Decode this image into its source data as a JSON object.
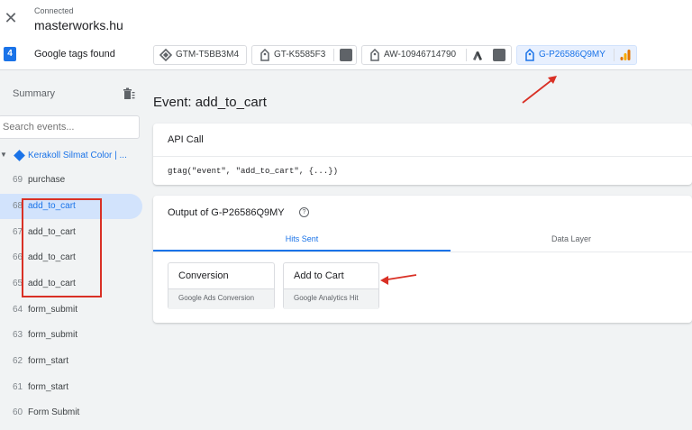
{
  "header": {
    "status": "Connected",
    "domain": "masterworks.hu"
  },
  "tags_bar": {
    "count": "4",
    "label": "Google tags found",
    "tags": [
      {
        "id": "GTM-T5BB3M4",
        "icon": "gtm-diamond-icon"
      },
      {
        "id": "GT-K5585F3",
        "icon": "tag-icon"
      },
      {
        "id": "AW-10946714790",
        "icon": "tag-icon"
      },
      {
        "id": "G-P26586Q9MY",
        "icon": "tag-icon",
        "active": true
      }
    ]
  },
  "sidebar": {
    "summary_label": "Summary",
    "search_placeholder": "Search events...",
    "container_name": "Kerakoll Silmat Color | ...",
    "events": [
      {
        "num": "69",
        "label": "purchase"
      },
      {
        "num": "68",
        "label": "add_to_cart",
        "selected": true
      },
      {
        "num": "67",
        "label": "add_to_cart"
      },
      {
        "num": "66",
        "label": "add_to_cart"
      },
      {
        "num": "65",
        "label": "add_to_cart"
      },
      {
        "num": "64",
        "label": "form_submit"
      },
      {
        "num": "63",
        "label": "form_submit"
      },
      {
        "num": "62",
        "label": "form_start"
      },
      {
        "num": "61",
        "label": "form_start"
      },
      {
        "num": "60",
        "label": "Form Submit"
      }
    ]
  },
  "main": {
    "event_title": "Event: add_to_cart",
    "api_card": {
      "title": "API Call",
      "code": "gtag(\"event\", \"add_to_cart\", {...})"
    },
    "output_card": {
      "title": "Output of G-P26586Q9MY",
      "tabs": [
        "Hits Sent",
        "Data Layer"
      ],
      "hits": [
        {
          "title": "Conversion",
          "subtitle": "Google Ads Conversion"
        },
        {
          "title": "Add to Cart",
          "subtitle": "Google Analytics Hit"
        }
      ]
    }
  },
  "colors": {
    "accent": "#1a73e8",
    "annotation": "#d93025"
  }
}
